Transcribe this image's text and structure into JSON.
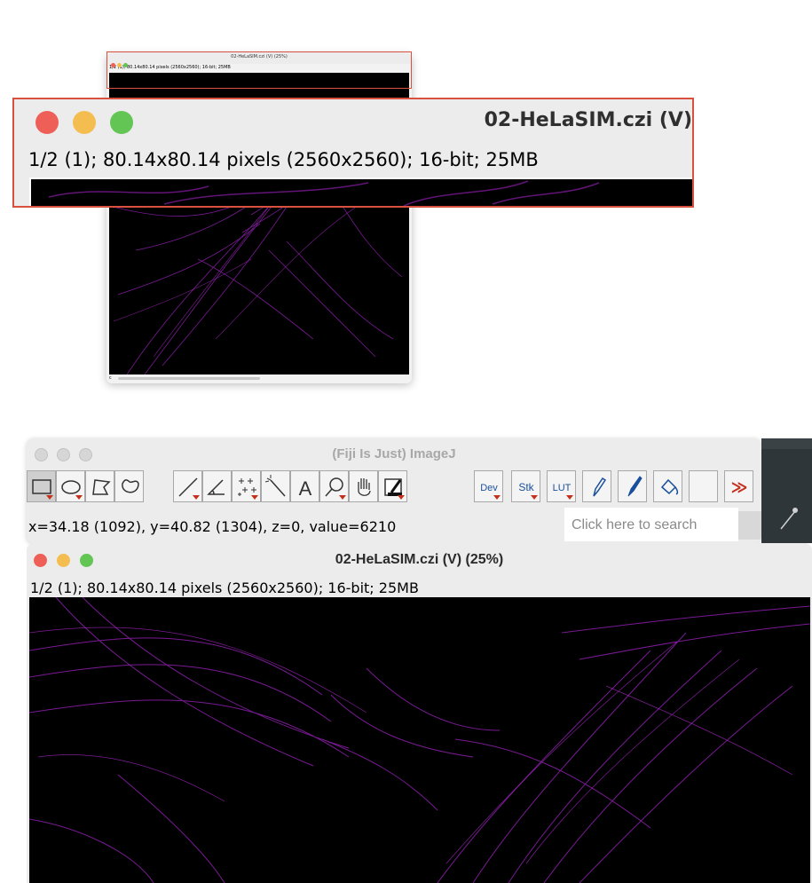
{
  "small_window": {
    "title": "02-HeLaSIM.czi (V) (25%)",
    "info": "1/2 (1); 80.14x80.14 pixels (2560x2560); 16-bit; 25MB",
    "status_letter": "c"
  },
  "zoom_callout": {
    "title": "02-HeLaSIM.czi (V)",
    "info": "1/2 (1); 80.14x80.14 pixels (2560x2560); 16-bit; 25MB"
  },
  "fiji": {
    "title": "(Fiji Is Just) ImageJ",
    "tools": [
      {
        "name": "rectangle-tool",
        "label": ""
      },
      {
        "name": "oval-tool",
        "label": ""
      },
      {
        "name": "polygon-tool",
        "label": ""
      },
      {
        "name": "freehand-tool",
        "label": ""
      },
      {
        "name": "line-tool",
        "label": ""
      },
      {
        "name": "angle-tool",
        "label": ""
      },
      {
        "name": "multipoint-tool",
        "label": ""
      },
      {
        "name": "wand-tool",
        "label": ""
      },
      {
        "name": "text-tool",
        "label": "A"
      },
      {
        "name": "magnifier-tool",
        "label": ""
      },
      {
        "name": "hand-tool",
        "label": ""
      },
      {
        "name": "color-picker-tool",
        "label": ""
      },
      {
        "name": "dev-menu",
        "label": "Dev"
      },
      {
        "name": "stk-menu",
        "label": "Stk"
      },
      {
        "name": "lut-menu",
        "label": "LUT"
      },
      {
        "name": "pencil-tool",
        "label": ""
      },
      {
        "name": "brush-tool",
        "label": ""
      },
      {
        "name": "flood-fill-tool",
        "label": ""
      },
      {
        "name": "empty-slot",
        "label": ""
      },
      {
        "name": "more-tools",
        "label": "≫"
      }
    ],
    "coords": "x=34.18 (1092), y=40.82 (1304), z=0, value=6210",
    "search_placeholder": "Click here to search"
  },
  "big_window": {
    "title": "02-HeLaSIM.czi (V) (25%)",
    "info": "1/2 (1); 80.14x80.14 pixels (2560x2560); 16-bit; 25MB"
  },
  "colors": {
    "close": "#ee5f57",
    "minimize": "#f4bd4f",
    "zoom": "#62c554",
    "highlight": "#d9503f",
    "fluorescence": "#a326c4",
    "inactive_dot": "#d6d6d6"
  }
}
